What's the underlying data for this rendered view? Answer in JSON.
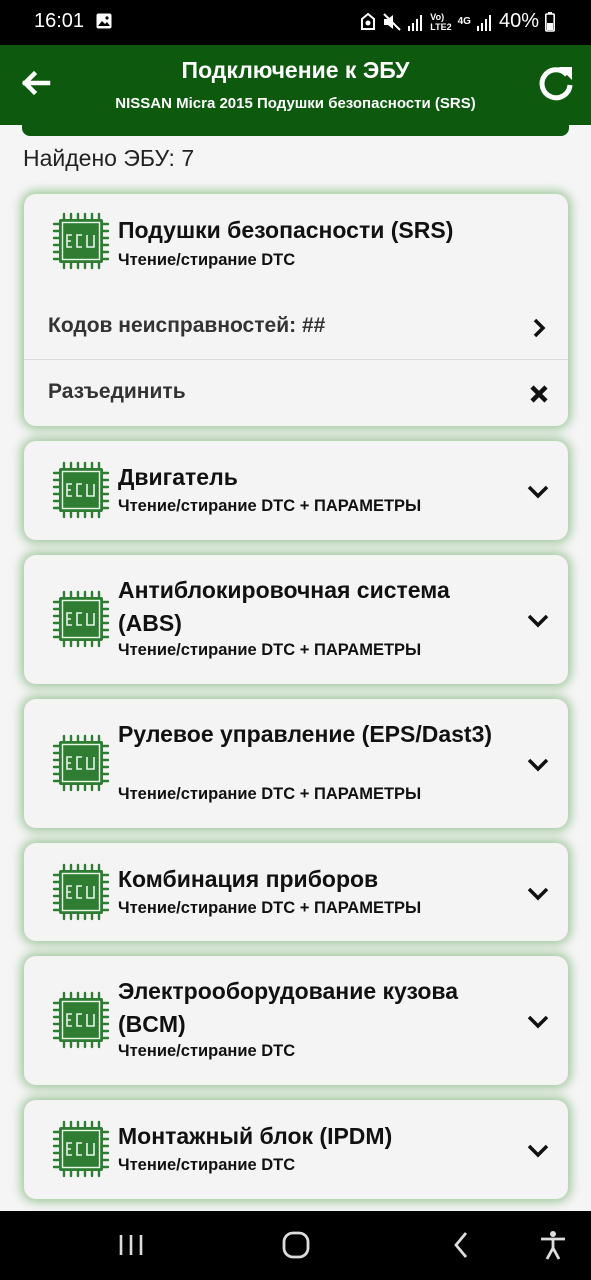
{
  "status_bar": {
    "time": "16:01",
    "battery": "40%",
    "network_label_1": "Vo)",
    "network_label_2": "LTE2",
    "network_gen": "4G"
  },
  "header": {
    "title": "Подключение к ЭБУ",
    "subtitle": "NISSAN Micra 2015 Подушки безопасности (SRS)",
    "back_icon": "arrow-left-icon",
    "refresh_icon": "refresh-icon"
  },
  "found_text": "Найдено ЭБУ: 7",
  "colors": {
    "primary": "#0d5a0f",
    "card_glow": "#55a050",
    "ecu_green": "#2e7d32"
  },
  "ecu_icon_label": "ECU",
  "ecus": [
    {
      "title": "Подушки безопасности (SRS)",
      "subtitle": "Чтение/стирание DTC",
      "expanded": true,
      "rows": [
        {
          "label": "Кодов неисправностей: ##",
          "icon": "chevron-right-icon"
        },
        {
          "label": "Разъединить",
          "icon": "close-icon"
        }
      ]
    },
    {
      "title": "Двигатель",
      "subtitle": "Чтение/стирание DTC + ПАРАМЕТРЫ",
      "expanded": false
    },
    {
      "title": "Антиблокировочная система (ABS)",
      "subtitle": "Чтение/стирание DTC + ПАРАМЕТРЫ",
      "expanded": false
    },
    {
      "title": "Рулевое управление (EPS/Dast3)",
      "subtitle": "Чтение/стирание DTC + ПАРАМЕТРЫ",
      "expanded": false
    },
    {
      "title": "Комбинация приборов",
      "subtitle": "Чтение/стирание DTC + ПАРАМЕТРЫ",
      "expanded": false
    },
    {
      "title": "Электрооборудование кузова (BCM)",
      "subtitle": "Чтение/стирание DTC",
      "expanded": false
    },
    {
      "title": "Монтажный блок (IPDM)",
      "subtitle": "Чтение/стирание DTC",
      "expanded": false
    }
  ],
  "nav_bar": {
    "recents_icon": "recents-icon",
    "home_icon": "home-icon",
    "back_icon": "back-icon",
    "accessibility_icon": "accessibility-icon"
  }
}
